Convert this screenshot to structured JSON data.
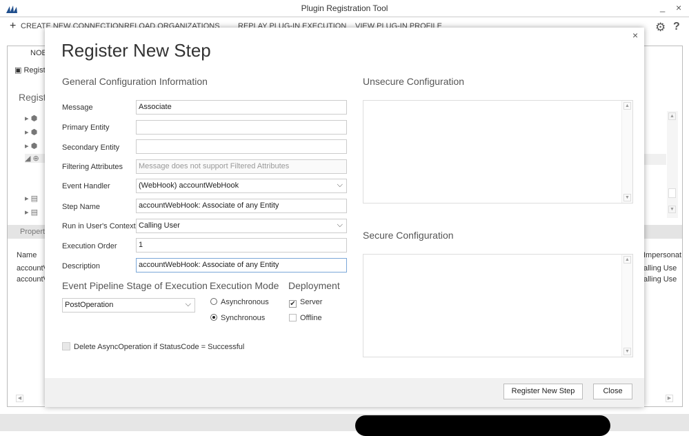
{
  "window": {
    "title": "Plugin Registration Tool",
    "minimize": "_",
    "close": "×"
  },
  "toolbar": {
    "create": "CREATE NEW CONNECTION",
    "reload": "RELOAD ORGANIZATIONS",
    "replay": "REPLAY PLUG-IN EXECUTION",
    "view": "VIEW PLUG-IN PROFILE"
  },
  "background": {
    "tab": "NOE",
    "register": "Regist",
    "registered": "Registe",
    "properties": "Propert",
    "name_col": "Name",
    "rows": [
      "accountV",
      "accountV"
    ],
    "right_col": "Impersonat",
    "right_rows": [
      "alling Use",
      "alling Use"
    ]
  },
  "dialog": {
    "title": "Register New Step",
    "close": "×",
    "general_heading": "General Configuration Information",
    "fields": [
      {
        "label": "Message",
        "value": "Associate"
      },
      {
        "label": "Primary Entity",
        "value": ""
      },
      {
        "label": "Secondary Entity",
        "value": ""
      },
      {
        "label": "Filtering Attributes",
        "placeholder": "Message does not support Filtered Attributes"
      },
      {
        "label": "Event Handler",
        "value": "(WebHook) accountWebHook"
      },
      {
        "label": "Step Name",
        "value": "accountWebHook: Associate of any Entity"
      },
      {
        "label": "Run in User's Context",
        "value": "Calling User"
      },
      {
        "label": "Execution Order",
        "value": "1"
      },
      {
        "label": "Description",
        "value": "accountWebHook: Associate of any Entity"
      }
    ],
    "pipeline": {
      "heading": "Event Pipeline Stage of Execution",
      "value": "PostOperation"
    },
    "mode": {
      "heading": "Execution Mode",
      "options": [
        "Asynchronous",
        "Synchronous"
      ],
      "selected": "Synchronous"
    },
    "deployment": {
      "heading": "Deployment",
      "server": "Server",
      "server_checked": true,
      "offline": "Offline",
      "offline_checked": false
    },
    "delete_async": {
      "label": "Delete AsyncOperation if StatusCode = Successful",
      "checked": false
    },
    "unsecure_heading": "Unsecure  Configuration",
    "secure_heading": "Secure  Configuration",
    "register_button": "Register New Step",
    "close_button": "Close"
  }
}
